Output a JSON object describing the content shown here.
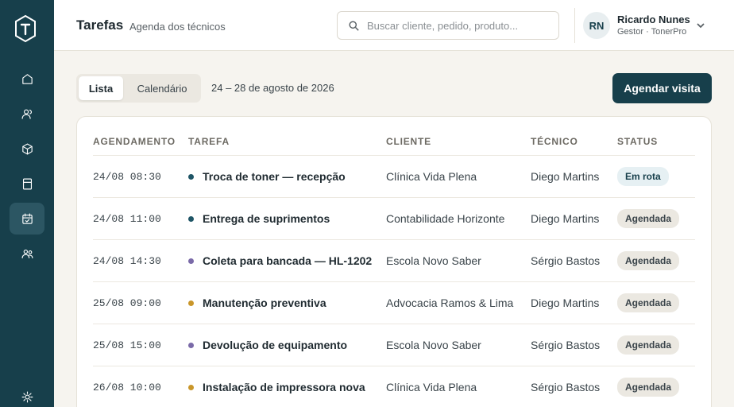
{
  "header": {
    "title": "Tarefas",
    "subtitle": "Agenda dos técnicos",
    "search_placeholder": "Buscar cliente, pedido, produto...",
    "user": {
      "initials": "RN",
      "name": "Ricardo Nunes",
      "role": "Gestor · TonerPro"
    }
  },
  "sidebar": {
    "items": [
      {
        "icon": "home-icon"
      },
      {
        "icon": "clients-icon"
      },
      {
        "icon": "box-icon"
      },
      {
        "icon": "orders-icon"
      },
      {
        "icon": "calendar-icon",
        "active": true
      },
      {
        "icon": "team-icon"
      },
      {
        "icon": "settings-icon"
      }
    ]
  },
  "toolbar": {
    "tabs": [
      {
        "label": "Lista",
        "active": true
      },
      {
        "label": "Calendário",
        "active": false
      }
    ],
    "date_range": "24 – 28 de agosto de 2026",
    "schedule_button": "Agendar visita"
  },
  "table": {
    "headers": {
      "schedule": "AGENDAMENTO",
      "task": "TAREFA",
      "client": "CLIENTE",
      "technician": "TÉCNICO",
      "status": "STATUS"
    },
    "rows": [
      {
        "schedule": "24/08 08:30",
        "task": "Troca de toner — recepção",
        "dot_color": "#1f5566",
        "client": "Clínica Vida Plena",
        "technician": "Diego Martins",
        "status": "Em rota",
        "status_kind": "rota"
      },
      {
        "schedule": "24/08 11:00",
        "task": "Entrega de suprimentos",
        "dot_color": "#1f5566",
        "client": "Contabilidade Horizonte",
        "technician": "Diego Martins",
        "status": "Agendada",
        "status_kind": "agendada"
      },
      {
        "schedule": "24/08 14:30",
        "task": "Coleta para bancada — HL-1202",
        "dot_color": "#7a6aa8",
        "client": "Escola Novo Saber",
        "technician": "Sérgio Bastos",
        "status": "Agendada",
        "status_kind": "agendada"
      },
      {
        "schedule": "25/08 09:00",
        "task": "Manutenção preventiva",
        "dot_color": "#c9962a",
        "client": "Advocacia Ramos & Lima",
        "technician": "Diego Martins",
        "status": "Agendada",
        "status_kind": "agendada"
      },
      {
        "schedule": "25/08 15:00",
        "task": "Devolução de equipamento",
        "dot_color": "#7a6aa8",
        "client": "Escola Novo Saber",
        "technician": "Sérgio Bastos",
        "status": "Agendada",
        "status_kind": "agendada"
      },
      {
        "schedule": "26/08 10:00",
        "task": "Instalação de impressora nova",
        "dot_color": "#c9962a",
        "client": "Clínica Vida Plena",
        "technician": "Sérgio Bastos",
        "status": "Agendada",
        "status_kind": "agendada"
      }
    ]
  }
}
